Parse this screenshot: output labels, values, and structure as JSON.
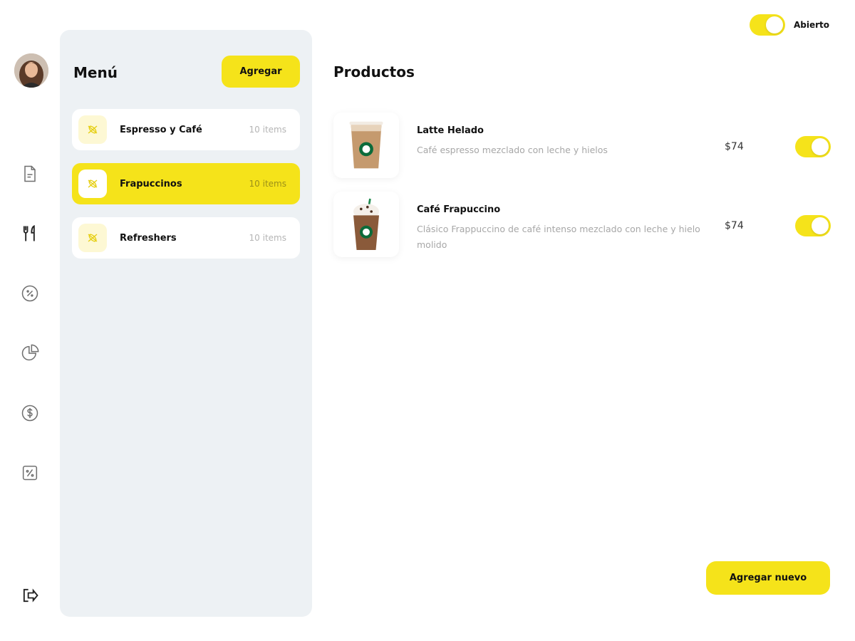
{
  "header": {
    "status_label": "Abierto",
    "status_on": true
  },
  "rail": {
    "icons": [
      "document-icon",
      "utensils-icon",
      "discount-icon",
      "pie-chart-icon",
      "dollar-icon",
      "percent-tag-icon",
      "logout-icon"
    ]
  },
  "menu": {
    "title": "Menú",
    "add_label": "Agregar",
    "categories": [
      {
        "name": "Espresso y Café",
        "count": "10 items",
        "active": false
      },
      {
        "name": "Frapuccinos",
        "count": "10 items",
        "active": true
      },
      {
        "name": "Refreshers",
        "count": "10 items",
        "active": false
      }
    ]
  },
  "products": {
    "title": "Productos",
    "items": [
      {
        "name": "Latte Helado",
        "description": "Café espresso mezclado con leche y hielos",
        "price": "$74",
        "enabled": true
      },
      {
        "name": "Café Frapuccino",
        "description": "Clásico Frappuccino de café intenso mezclado con leche y hielo molido",
        "price": "$74",
        "enabled": true
      }
    ],
    "add_new_label": "Agregar nuevo"
  },
  "colors": {
    "accent": "#f5e31a",
    "panel": "#edf1f4",
    "muted_text": "#a7a7a7"
  }
}
